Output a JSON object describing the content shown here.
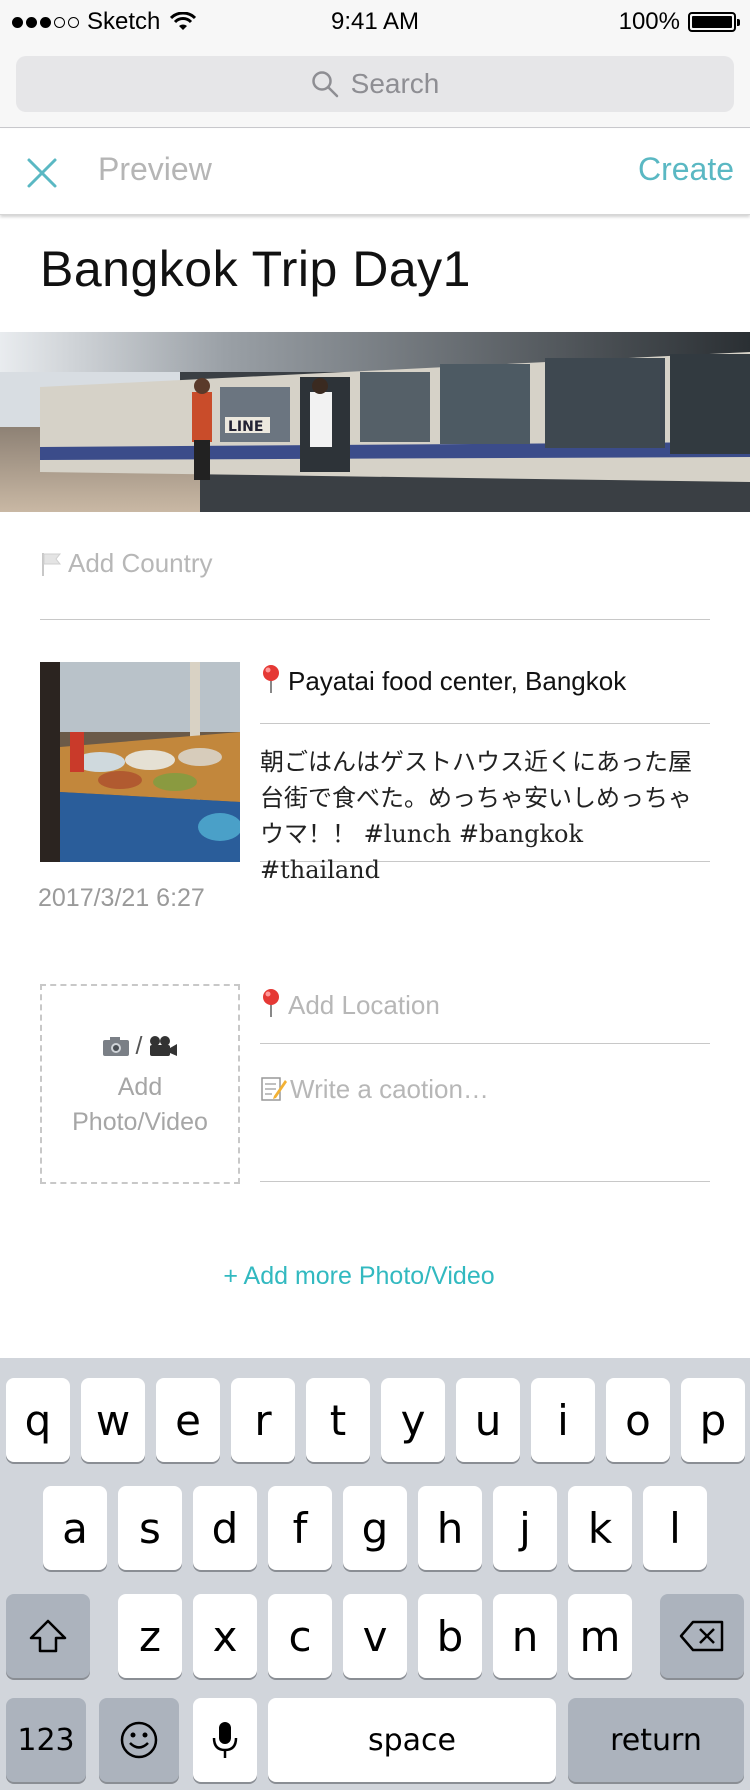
{
  "status_bar": {
    "carrier": "Sketch",
    "time": "9:41 AM",
    "battery": "100%"
  },
  "search": {
    "placeholder": "Search"
  },
  "nav": {
    "close_icon": "close-x-icon",
    "preview_label": "Preview",
    "create_label": "Create"
  },
  "trip": {
    "title": "Bangkok Trip Day1"
  },
  "country": {
    "placeholder": "Add Country",
    "icon": "flag-icon"
  },
  "entry": {
    "location": "Payatai food center, Bangkok",
    "caption_lines": [
      "朝ごはんはゲストハウス近くにあった屋",
      "台街で食べた。めっちゃ安いしめっちゃ",
      "ウマ！！ #lunch #bangkok #thailand"
    ],
    "date": "2017/3/21 6:27"
  },
  "add_media": {
    "icons_separator": "/",
    "label_line1": "Add",
    "label_line2": "Photo/Video",
    "location_placeholder": "Add Location",
    "caption_placeholder": "Write a caotion…"
  },
  "add_more_label": "+ Add more Photo/Video",
  "keyboard": {
    "row1": [
      "q",
      "w",
      "e",
      "r",
      "t",
      "y",
      "u",
      "i",
      "o",
      "p"
    ],
    "row2": [
      "a",
      "s",
      "d",
      "f",
      "g",
      "h",
      "j",
      "k",
      "l"
    ],
    "row3": [
      "z",
      "x",
      "c",
      "v",
      "b",
      "n",
      "m"
    ],
    "numbers_label": "123",
    "space_label": "space",
    "return_label": "return"
  },
  "colors": {
    "accent": "#5ab8c3",
    "add_more": "#32b9c0",
    "placeholder": "#b7b7b7",
    "keyboard_bg": "#d1d5db"
  }
}
